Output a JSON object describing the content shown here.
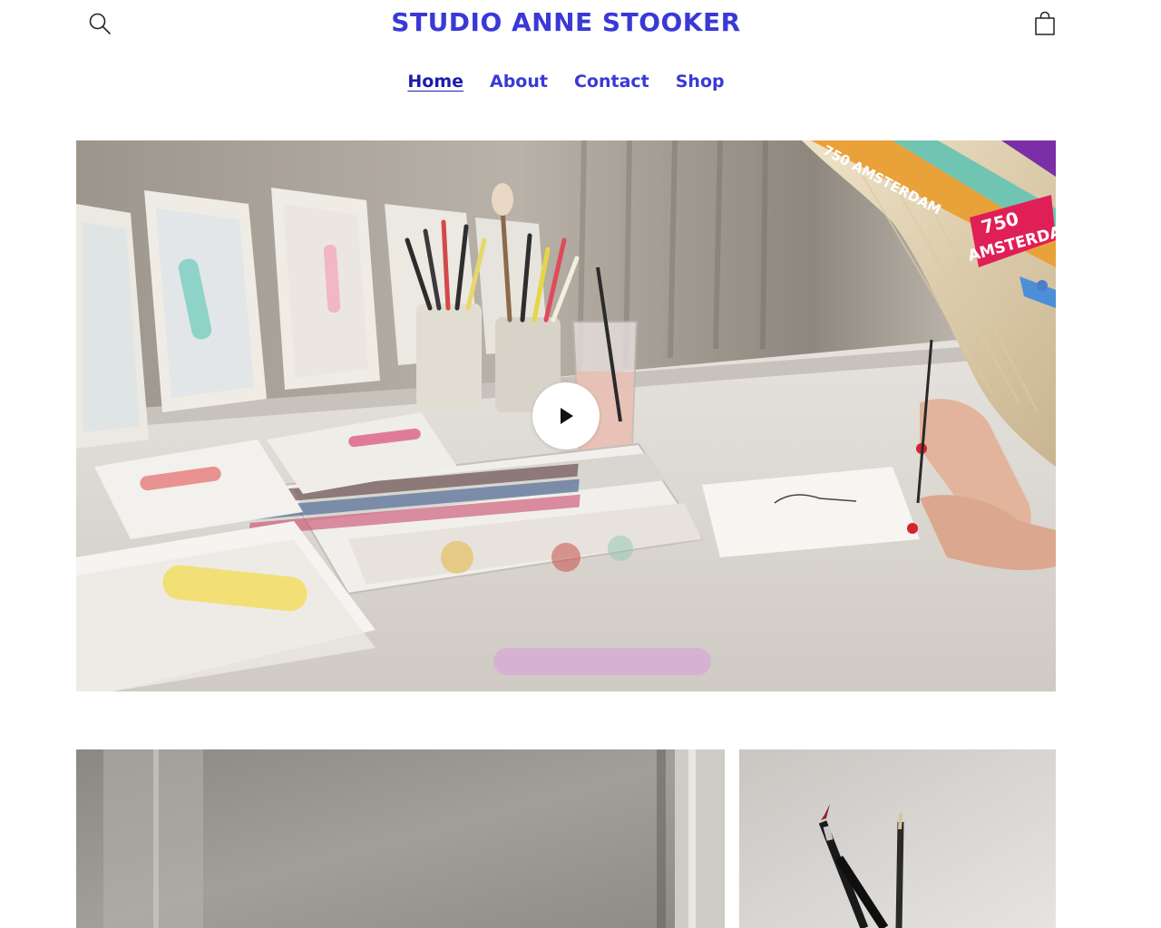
{
  "header": {
    "brand": "STUDIO ANNE STOOKER",
    "search_icon": "search-icon",
    "cart_icon": "cart-bag-icon"
  },
  "nav": {
    "items": [
      {
        "label": "Home",
        "active": true
      },
      {
        "label": "About",
        "active": false
      },
      {
        "label": "Contact",
        "active": false
      },
      {
        "label": "Shop",
        "active": false
      }
    ]
  },
  "hero": {
    "badge_line1": "750",
    "badge_line2": "AMSTERDAM",
    "ribbon_text": "750 AMSTERDAM",
    "play_icon": "play-icon"
  },
  "colors": {
    "accent": "#3a39d6",
    "accent_active": "#1d1ca8",
    "background": "#ffffff"
  }
}
